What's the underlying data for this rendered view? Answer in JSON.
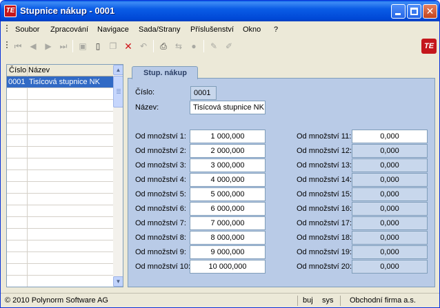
{
  "window": {
    "title": "Stupnice nákup - 0001",
    "logo_text": "TE"
  },
  "menu": {
    "items": [
      "Soubor",
      "Zpracování",
      "Navigace",
      "Sada/Strany",
      "Příslušenství",
      "Okno",
      "?"
    ]
  },
  "toolbar": {
    "icons": [
      "first-record-icon",
      "previous-record-icon",
      "next-record-icon",
      "last-record-icon",
      "save-icon",
      "new-document-icon",
      "copy-icon",
      "delete-icon",
      "undo-icon",
      "print-icon",
      "export-icon",
      "lock-icon",
      "edit-icon",
      "edit-alt-icon"
    ],
    "brand_logo": "TE"
  },
  "list": {
    "columns": [
      "Číslo",
      "Název"
    ],
    "rows": [
      {
        "cislo": "0001",
        "nazev": "Tisícová stupnice NK",
        "selected": true
      }
    ]
  },
  "form": {
    "tab_label": "Stup. nákup",
    "cislo_label": "Číslo:",
    "cislo_value": "0001",
    "nazev_label": "Název:",
    "nazev_value": "Tisícová stupnice NK",
    "left_fields": [
      {
        "label": "Od množství 1:",
        "value": "1 000,000"
      },
      {
        "label": "Od množství 2:",
        "value": "2 000,000"
      },
      {
        "label": "Od množství 3:",
        "value": "3 000,000"
      },
      {
        "label": "Od množství 4:",
        "value": "4 000,000"
      },
      {
        "label": "Od množství 5:",
        "value": "5 000,000"
      },
      {
        "label": "Od množství 6:",
        "value": "6 000,000"
      },
      {
        "label": "Od množství 7:",
        "value": "7 000,000"
      },
      {
        "label": "Od množství 8:",
        "value": "8 000,000"
      },
      {
        "label": "Od množství 9:",
        "value": "9 000,000"
      },
      {
        "label": "Od množství 10:",
        "value": "10 000,000"
      }
    ],
    "right_fields": [
      {
        "label": "Od množství 11:",
        "value": "0,000"
      },
      {
        "label": "Od množství 12:",
        "value": "0,000"
      },
      {
        "label": "Od množství 13:",
        "value": "0,000"
      },
      {
        "label": "Od množství 14:",
        "value": "0,000"
      },
      {
        "label": "Od množství 15:",
        "value": "0,000"
      },
      {
        "label": "Od množství 16:",
        "value": "0,000"
      },
      {
        "label": "Od množství 17:",
        "value": "0,000"
      },
      {
        "label": "Od množství 18:",
        "value": "0,000"
      },
      {
        "label": "Od množství 19:",
        "value": "0,000"
      },
      {
        "label": "Od množství 20:",
        "value": "0,000"
      }
    ]
  },
  "status": {
    "copyright": "© 2010 Polynorm Software AG",
    "user1": "buj",
    "user2": "sys",
    "company": "Obchodní firma a.s."
  },
  "colors": {
    "titlebar": "#0a5ce6",
    "selection": "#316ac5",
    "form_bg": "#b9cbe7"
  }
}
